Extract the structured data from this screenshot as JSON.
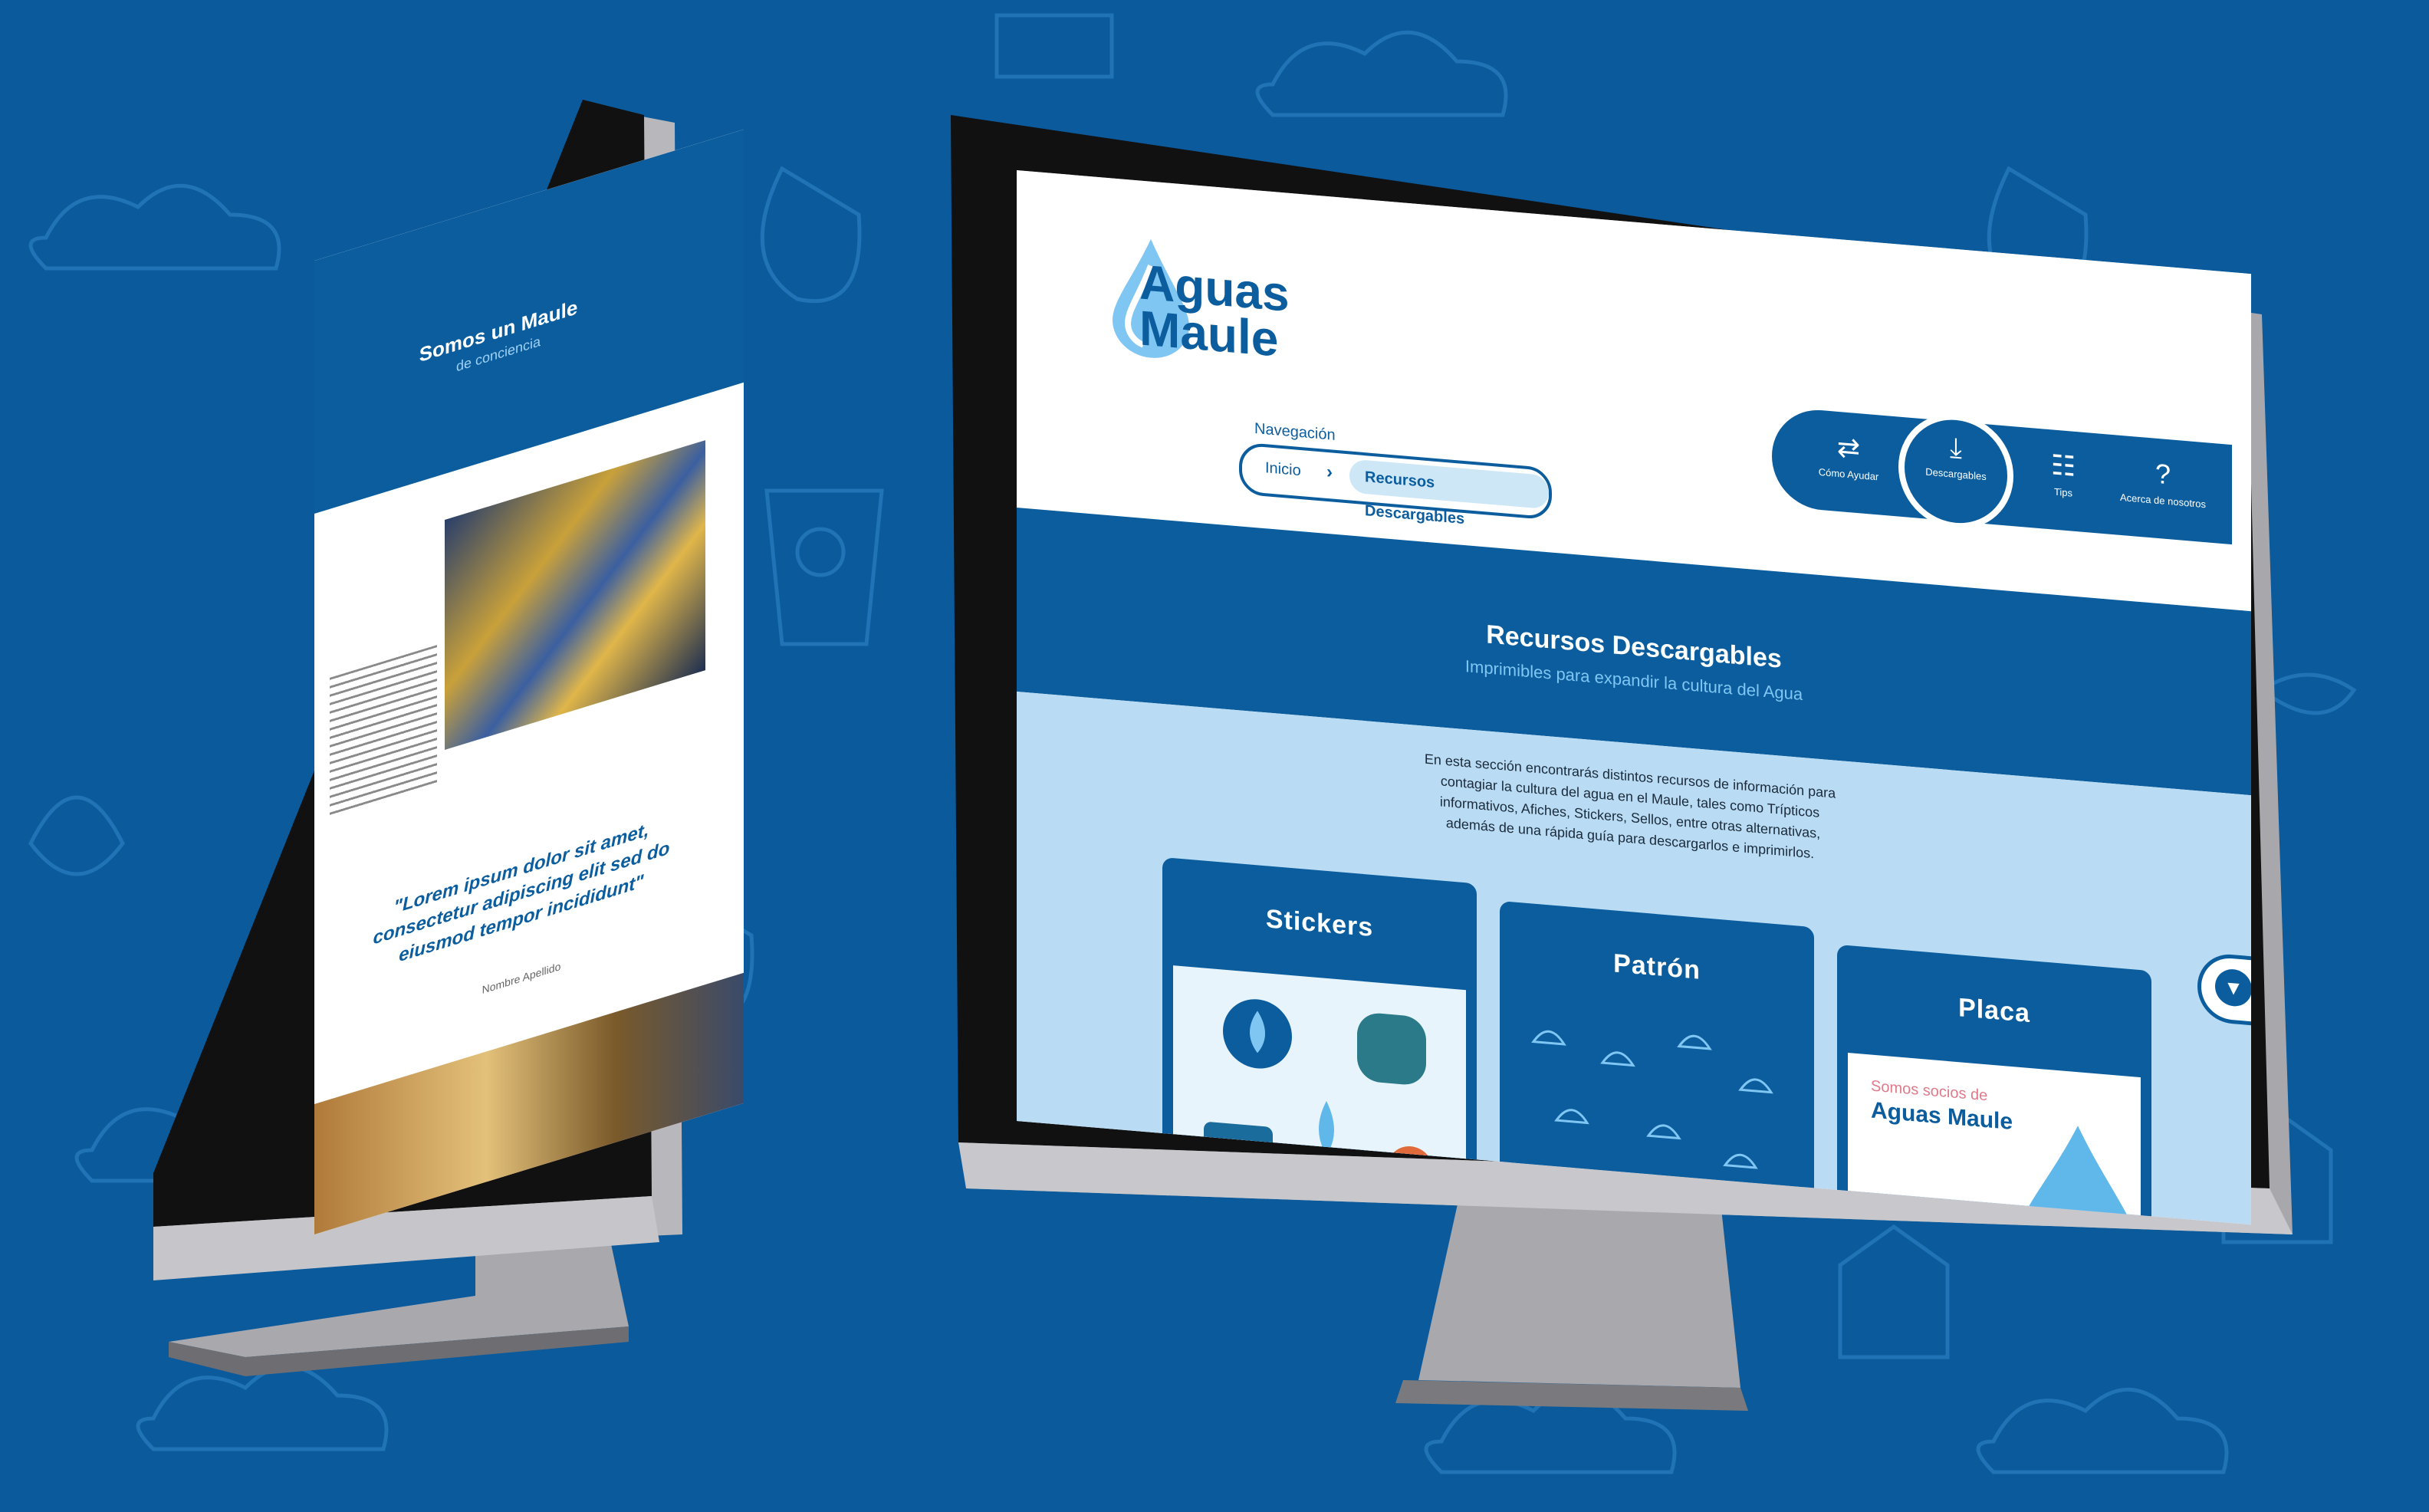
{
  "brand": {
    "name_line1": "Aguas",
    "name_line2": "Maule",
    "primary": "#0b5d9e",
    "light": "#b9dcf4",
    "accent": "#7fc6f3"
  },
  "left_screen": {
    "title": "Somos un Maule",
    "subtitle": "de conciencia",
    "quote": "\"Lorem ipsum dolor sit amet, consectetur adipiscing elit sed do eiusmod tempor incididunt\"",
    "author": "Nombre Apellido"
  },
  "right_screen": {
    "nav_label": "Navegación",
    "breadcrumb": {
      "home": "Inicio",
      "separator": "›",
      "current": "Recursos Descargables"
    },
    "top_nav": [
      {
        "icon": "handshake-icon",
        "glyph": "⇄",
        "label": "Cómo Ayudar"
      },
      {
        "icon": "download-icon",
        "glyph": "⤓",
        "label": "Descargables",
        "active": true
      },
      {
        "icon": "chat-icon",
        "glyph": "☷",
        "label": "Tips"
      },
      {
        "icon": "help-icon",
        "glyph": "?",
        "label": "Acerca de nosotros"
      }
    ],
    "hero": {
      "title": "Recursos Descargables",
      "subtitle": "Imprimibles para expandir la cultura del Agua"
    },
    "intro": "En esta sección encontrarás distintos recursos de información para contagiar la cultura del agua en el Maule, tales como Trípticos informativos, Afiches, Stickers, Sellos, entre otras alternativas, además de una rápida guía para descargarlos e imprimirlos.",
    "cards": [
      {
        "title": "Stickers"
      },
      {
        "title": "Patrón"
      },
      {
        "title": "Placa",
        "placa_line1": "Somos socios de",
        "placa_line2": "Aguas Maule"
      }
    ],
    "scroll_glyph": "▼"
  }
}
